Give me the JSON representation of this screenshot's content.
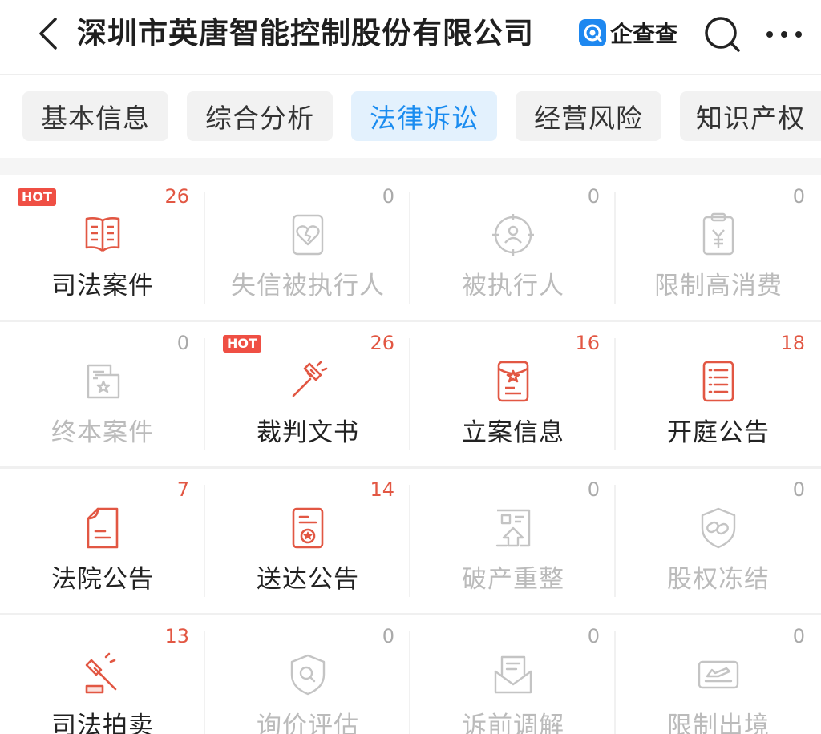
{
  "header": {
    "title": "深圳市英唐智能控制股份有限公司",
    "brand_name": "企查查"
  },
  "tabs": [
    {
      "label": "基本信息",
      "active": false
    },
    {
      "label": "综合分析",
      "active": false
    },
    {
      "label": "法律诉讼",
      "active": true
    },
    {
      "label": "经营风险",
      "active": false
    },
    {
      "label": "知识产权",
      "active": false
    }
  ],
  "colors": {
    "accent_blue": "#1a8cf0",
    "accent_red": "#e25743",
    "inactive_gray": "#bbbbbb"
  },
  "items": [
    {
      "label": "司法案件",
      "count": "26",
      "hot": "HOT",
      "icon": "book-icon",
      "active": true
    },
    {
      "label": "失信被执行人",
      "count": "0",
      "icon": "broken-heart-icon",
      "active": false
    },
    {
      "label": "被执行人",
      "count": "0",
      "icon": "target-person-icon",
      "active": false
    },
    {
      "label": "限制高消费",
      "count": "0",
      "icon": "yen-clipboard-icon",
      "active": false
    },
    {
      "label": "终本案件",
      "count": "0",
      "icon": "folder-star-icon",
      "active": false
    },
    {
      "label": "裁判文书",
      "count": "26",
      "hot": "HOT",
      "icon": "gavel-icon",
      "active": true
    },
    {
      "label": "立案信息",
      "count": "16",
      "icon": "star-document-icon",
      "active": true
    },
    {
      "label": "开庭公告",
      "count": "18",
      "icon": "list-document-icon",
      "active": true
    },
    {
      "label": "法院公告",
      "count": "7",
      "icon": "document-icon",
      "active": true
    },
    {
      "label": "送达公告",
      "count": "14",
      "icon": "seal-document-icon",
      "active": true
    },
    {
      "label": "破产重整",
      "count": "0",
      "icon": "building-arrow-icon",
      "active": false
    },
    {
      "label": "股权冻结",
      "count": "0",
      "icon": "chain-shield-icon",
      "active": false
    },
    {
      "label": "司法拍卖",
      "count": "13",
      "icon": "auction-hammer-icon",
      "active": true
    },
    {
      "label": "询价评估",
      "count": "0",
      "icon": "search-shield-icon",
      "active": false
    },
    {
      "label": "诉前调解",
      "count": "0",
      "icon": "envelope-document-icon",
      "active": false
    },
    {
      "label": "限制出境",
      "count": "0",
      "icon": "airplane-ticket-icon",
      "active": false
    }
  ]
}
